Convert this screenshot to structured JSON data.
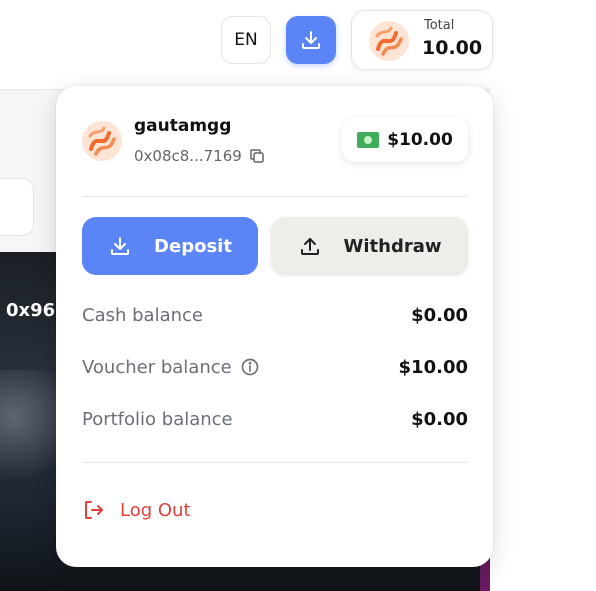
{
  "header": {
    "language": "EN",
    "total_label": "Total",
    "total_value": "10.00"
  },
  "background": {
    "card_text": "0x96"
  },
  "account": {
    "username": "gautamgg",
    "address": "0x08c8...7169",
    "balance": "$10.00"
  },
  "actions": {
    "deposit_label": "Deposit",
    "withdraw_label": "Withdraw"
  },
  "balances": [
    {
      "label": "Cash balance",
      "value": "$0.00"
    },
    {
      "label": "Voucher balance",
      "value": "$10.00"
    },
    {
      "label": "Portfolio balance",
      "value": "$0.00"
    }
  ],
  "logout_label": "Log Out",
  "colors": {
    "primary": "#5b84f7",
    "danger": "#e2403a",
    "avatar": "#f26a2e"
  },
  "icons": {
    "download": "download-icon",
    "upload": "upload-icon",
    "copy": "copy-icon",
    "info": "info-icon",
    "logout": "logout-icon",
    "cash": "cash-icon"
  }
}
